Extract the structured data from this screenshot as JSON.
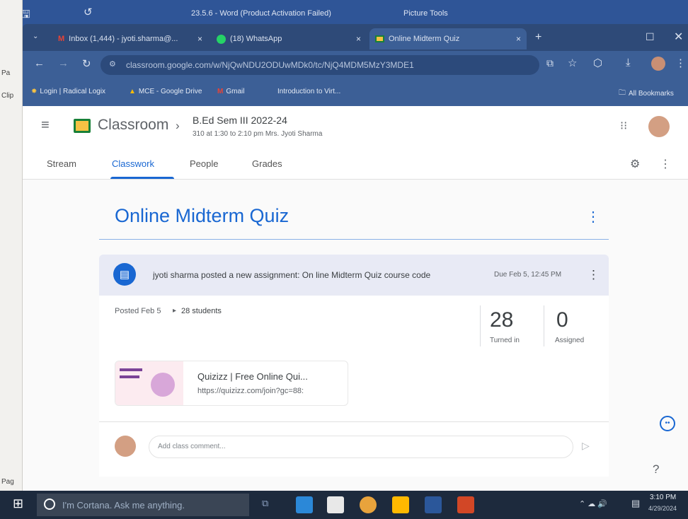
{
  "word_titlebar": {
    "title": "23.5.6 - Word (Product Activation Failed)",
    "picture_tools": "Picture Tools"
  },
  "word_left": {
    "items": [
      "Pa",
      "Clip",
      "Pag"
    ]
  },
  "browser": {
    "tabs": [
      {
        "label": "Inbox (1,444) - jyoti.sharma@...",
        "icon": "gmail-icon",
        "close": "×"
      },
      {
        "label": "(18) WhatsApp",
        "icon": "whatsapp-icon",
        "close": "×"
      },
      {
        "label": "Online Midterm Quiz",
        "icon": "classroom-icon",
        "close": "×"
      }
    ],
    "url": "classroom.google.com/w/NjQwNDU2ODUwMDk0/tc/NjQ4MDM5MzY3MDE1",
    "bookmarks": [
      "Login | Radical Logix",
      "MCE - Google Drive",
      "Gmail",
      "Introduction to Virt...",
      "All Bookmarks"
    ]
  },
  "classroom": {
    "brand": "Classroom",
    "course_name": "B.Ed Sem III 2022-24",
    "course_section": "310 at 1:30 to 2:10 pm Mrs. Jyoti Sharma",
    "tabs": [
      "Stream",
      "Classwork",
      "People",
      "Grades"
    ],
    "assignment_title": "Online Midterm Quiz",
    "post_text": "jyoti sharma posted a new assignment: On line Midterm Quiz course code",
    "due": "Due Feb 5, 12:45 PM",
    "posted": "Posted Feb 5",
    "students": "28 students",
    "turned_in_count": "28",
    "turned_in_label": "Turned in",
    "assigned_count": "0",
    "assigned_label": "Assigned",
    "attachment_title": "Quizizz | Free Online Qui...",
    "attachment_url": "https://quizizz.com/join?gc=88:",
    "comment_placeholder": "Add class comment..."
  },
  "taskbar": {
    "search_placeholder": "I'm Cortana. Ask me anything.",
    "time": "3:10 PM",
    "date": "4/29/2024"
  },
  "colors": {
    "accent": "#1967d2",
    "taskbar": "#1d2a3d"
  }
}
